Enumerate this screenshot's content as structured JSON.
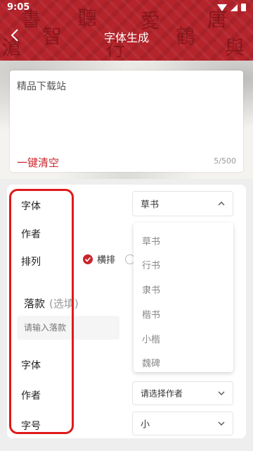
{
  "status": {
    "time": "9:05"
  },
  "header": {
    "title": "字体生成"
  },
  "editor": {
    "text": "精品下载站",
    "clear_label": "一键清空",
    "count": "5/500"
  },
  "settings": {
    "font_label": "字体",
    "font_value": "草书",
    "author_label": "作者",
    "layout_label": "排列",
    "layout_option_horizontal": "横排",
    "signature_title": "落款",
    "signature_optional": "(选填)",
    "signature_placeholder": "请输入落款",
    "sig_font_label": "字体",
    "sig_author_label": "作者",
    "sig_author_value": "请选择作者",
    "size_label": "字号",
    "size_value": "小"
  },
  "dropdown": {
    "options": [
      "草书",
      "行书",
      "隶书",
      "楷书",
      "小楷",
      "魏碑"
    ]
  },
  "colors": {
    "accent": "#c8262d",
    "header_bg": "#b5232b",
    "highlight": "#e01a1a"
  }
}
